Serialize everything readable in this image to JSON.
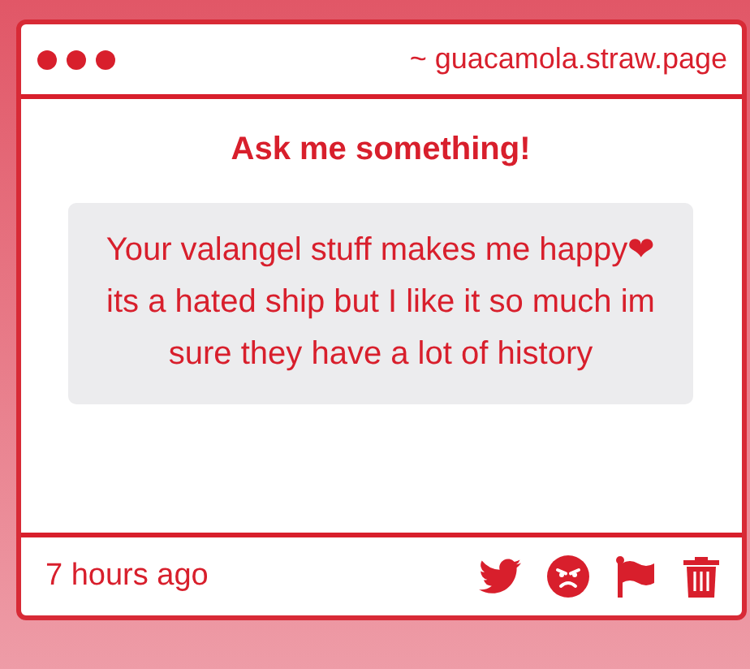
{
  "address": "~ guacamola.straw.page",
  "heading": "Ask me something!",
  "message": "Your valangel stuff makes me happy❤ its a hated ship but I like it so much im sure they have a lot of history",
  "footer": {
    "time": "7 hours ago"
  }
}
